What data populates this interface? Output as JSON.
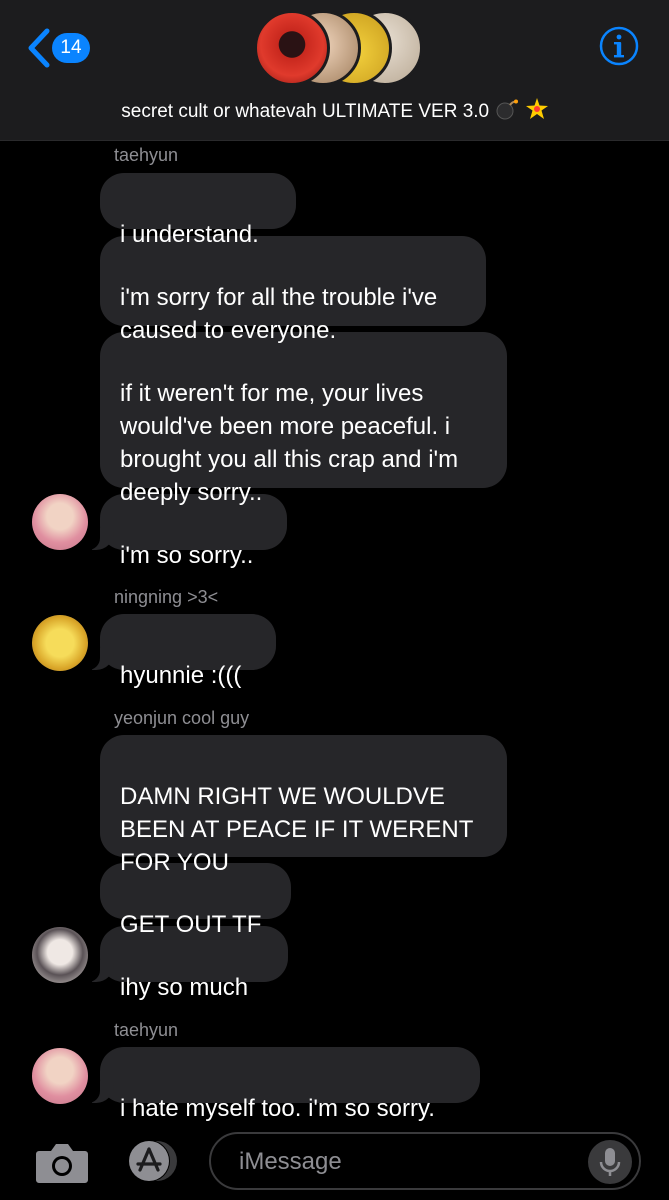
{
  "header": {
    "back_count": "14",
    "title": "secret cult or whatevah ULTIMATE VER 3.0",
    "group_avatar_colors": [
      "#c8281e",
      "#d9b48c",
      "#e8c23c",
      "#cfc4b4"
    ]
  },
  "messages": [
    {
      "sender": "taehyun",
      "lines": [
        "i understand.",
        "i'm sorry for all the trouble i've\ncaused to everyone.",
        "if it weren't for me, your lives\nwould've been more peaceful. i\nbrought you all this crap and i'm\ndeeply sorry..",
        "i'm so sorry.."
      ]
    },
    {
      "sender": "ningning >3<",
      "lines": [
        "hyunnie :((("
      ]
    },
    {
      "sender": "yeonjun cool guy",
      "lines": [
        "DAMN RIGHT WE WOULDVE\nBEEN AT PEACE IF IT WERENT\nFOR YOU",
        "GET OUT TF",
        "ihy so much"
      ]
    },
    {
      "sender": "taehyun",
      "lines": [
        "i hate myself too. i'm so sorry."
      ]
    }
  ],
  "input": {
    "placeholder": "iMessage"
  },
  "colors": {
    "accent": "#0a84ff",
    "bubble": "#262629",
    "header_bg": "#1c1c1e",
    "sender": "#8e8e93"
  },
  "icons": [
    "chevron-left-icon",
    "info-icon",
    "camera-icon",
    "app-store-icon",
    "microphone-icon",
    "bomb-emoji",
    "sparkle-emoji"
  ]
}
